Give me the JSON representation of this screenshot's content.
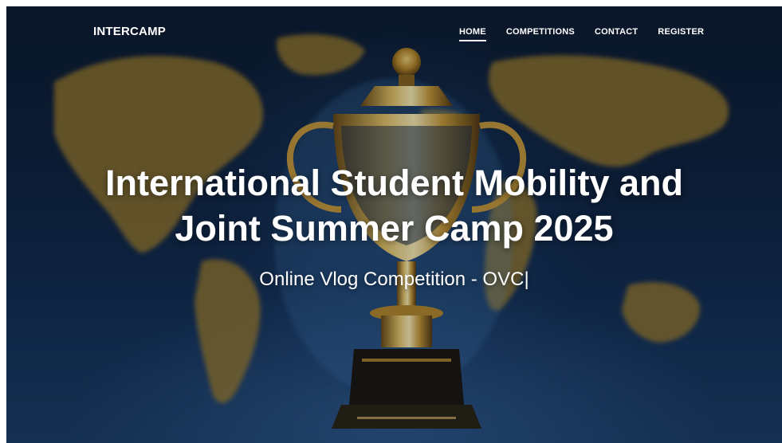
{
  "navbar": {
    "brand": "INTERCAMP",
    "links": [
      {
        "label": "HOME",
        "active": true
      },
      {
        "label": "COMPETITIONS",
        "active": false
      },
      {
        "label": "CONTACT",
        "active": false
      },
      {
        "label": "REGISTER",
        "active": false
      }
    ]
  },
  "hero": {
    "title_line1": "International Student Mobility and",
    "title_line2": "Joint Summer Camp 2025",
    "subtitle": "Online Vlog Competition - OVC|",
    "background_image": "trophy-over-world-map"
  },
  "colors": {
    "background": "#0f2342",
    "gold": "#c9a43c",
    "text": "#ffffff"
  }
}
